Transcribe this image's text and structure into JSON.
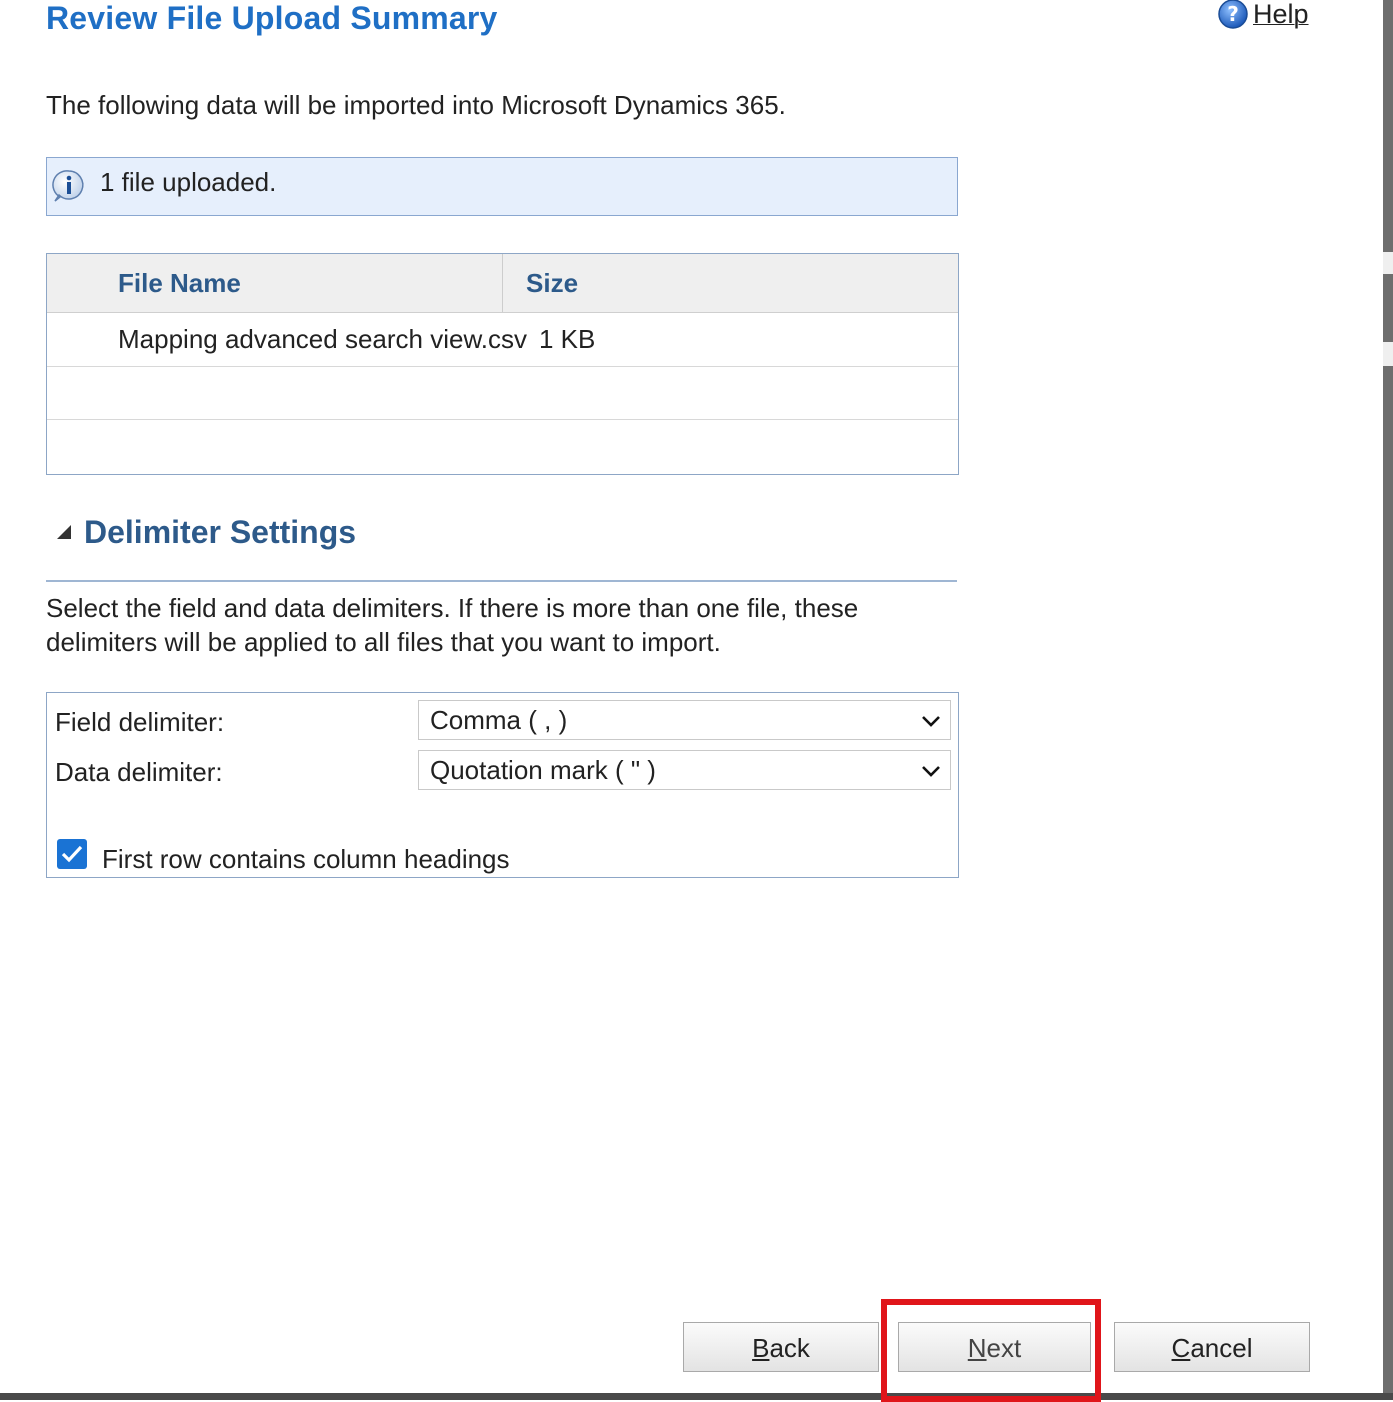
{
  "header": {
    "title": "Review File Upload Summary",
    "help_label": "Help",
    "help_accel": "H",
    "help_rest": "elp"
  },
  "intro_text": "The following data will be imported into Microsoft Dynamics 365.",
  "info_bar": {
    "text": "1 file uploaded.",
    "icon": "info-icon"
  },
  "file_table": {
    "columns": [
      "File Name",
      "Size"
    ],
    "rows": [
      {
        "name": "Mapping advanced search view.csv",
        "size": "1 KB"
      },
      {
        "name": "",
        "size": ""
      },
      {
        "name": "",
        "size": ""
      }
    ]
  },
  "delimiter_section": {
    "title": "Delimiter Settings",
    "expanded": true,
    "description": "Select the field and data delimiters. If there is more than one file, these delimiters will be applied to all files that you want to import.",
    "field_delimiter_label": "Field delimiter:",
    "field_delimiter_value": "Comma ( , )",
    "data_delimiter_label": "Data delimiter:",
    "data_delimiter_value": "Quotation mark ( \" )",
    "first_row_headings_label": "First row contains column headings",
    "first_row_headings_checked": true
  },
  "buttons": {
    "back": {
      "accel": "B",
      "rest": "ack"
    },
    "next": {
      "accel": "N",
      "rest": "ext"
    },
    "cancel": {
      "accel": "C",
      "rest": "ancel"
    }
  },
  "colors": {
    "title": "#1f6fc5",
    "section_title": "#2d5a8a",
    "info_bar_bg": "#e6effc",
    "checkbox": "#1a73d4",
    "highlight": "#e0151a"
  }
}
